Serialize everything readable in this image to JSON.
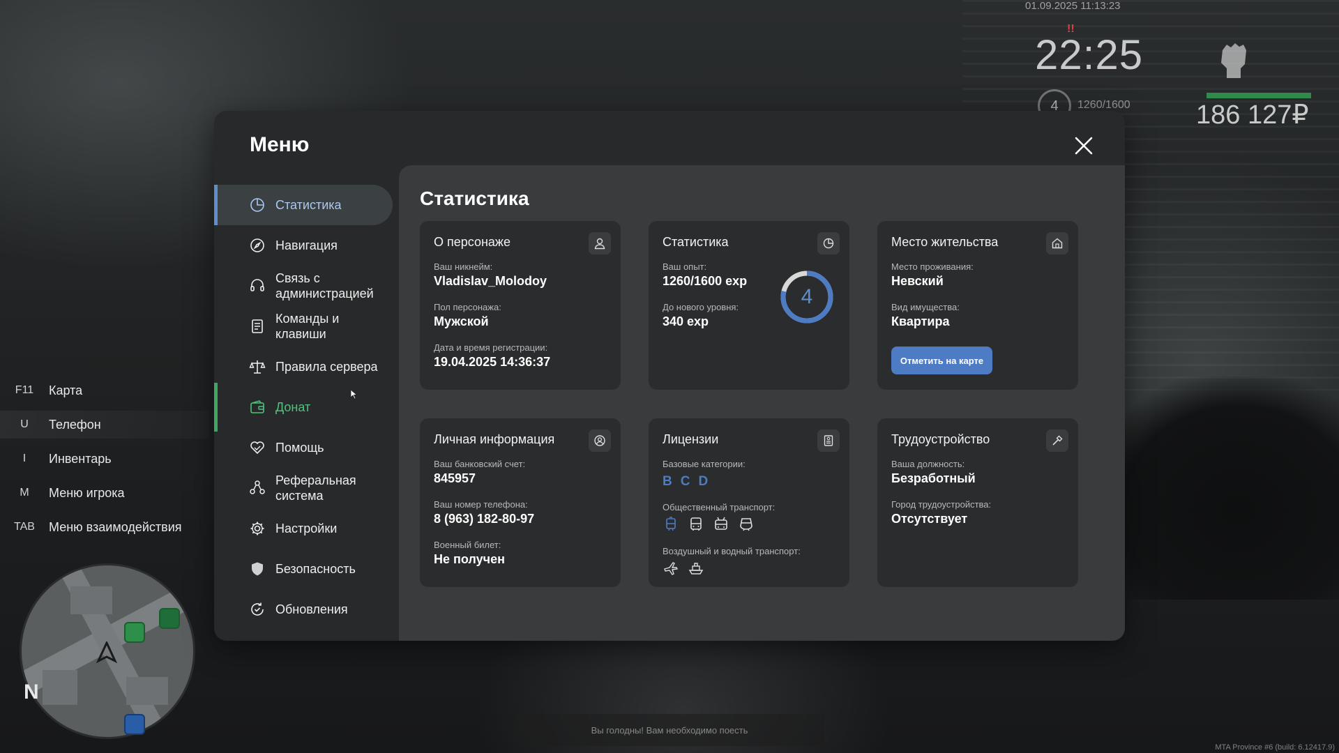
{
  "hud": {
    "datetime": "01.09.2025 11:13:23",
    "time": "22:25",
    "alert": "!!",
    "level": "4",
    "exp": "1260/1600",
    "money": "186 127₽"
  },
  "hotkeys": [
    {
      "key": "F11",
      "label": "Карта"
    },
    {
      "key": "U",
      "label": "Телефон"
    },
    {
      "key": "I",
      "label": "Инвентарь"
    },
    {
      "key": "M",
      "label": "Меню игрока"
    },
    {
      "key": "TAB",
      "label": "Меню взаимодействия"
    }
  ],
  "minimap": {
    "north": "N"
  },
  "menu": {
    "title": "Меню",
    "nav": [
      {
        "label": "Статистика",
        "icon": "chart-pie-icon"
      },
      {
        "label": "Навигация",
        "icon": "compass-icon"
      },
      {
        "label": "Связь с администрацией",
        "icon": "headset-icon"
      },
      {
        "label": "Команды и клавиши",
        "icon": "document-icon"
      },
      {
        "label": "Правила сервера",
        "icon": "scales-icon"
      },
      {
        "label": "Донат",
        "icon": "wallet-icon"
      },
      {
        "label": "Помощь",
        "icon": "handshake-icon"
      },
      {
        "label": "Реферальная система",
        "icon": "people-icon"
      },
      {
        "label": "Настройки",
        "icon": "gear-icon"
      },
      {
        "label": "Безопасность",
        "icon": "shield-icon"
      },
      {
        "label": "Обновления",
        "icon": "refresh-check-icon"
      }
    ]
  },
  "content": {
    "title": "Статистика",
    "character": {
      "title": "О персонаже",
      "nick_label": "Ваш никнейм:",
      "nick": "Vladislav_Molodoy",
      "gender_label": "Пол персонажа:",
      "gender": "Мужской",
      "reg_label": "Дата и время регистрации:",
      "reg": "19.04.2025 14:36:37"
    },
    "stats": {
      "title": "Статистика",
      "exp_label": "Ваш опыт:",
      "exp": "1260/1600 exp",
      "next_label": "До нового уровня:",
      "next": "340 exp",
      "level": "4",
      "progress": 0.7875
    },
    "residence": {
      "title": "Место жительства",
      "place_label": "Место проживания:",
      "place": "Невский",
      "type_label": "Вид имущества:",
      "type": "Квартира",
      "button": "Отметить на карте"
    },
    "personal": {
      "title": "Личная информация",
      "bank_label": "Ваш банковский счет:",
      "bank": "845957",
      "phone_label": "Ваш номер телефона:",
      "phone": "8 (963) 182-80-97",
      "military_label": "Военный билет:",
      "military": "Не получен"
    },
    "licenses": {
      "title": "Лицензии",
      "base_label": "Базовые категории:",
      "categories": [
        "B",
        "C",
        "D"
      ],
      "public_label": "Общественный транспорт:",
      "air_label": "Воздушный и водный транспорт:"
    },
    "employment": {
      "title": "Трудоустройство",
      "job_label": "Ваша должность:",
      "job": "Безработный",
      "city_label": "Город трудоустройства:",
      "city": "Отсутствует"
    }
  },
  "hint": "Вы голодны! Вам необходимо поесть",
  "build": "MTA Province #6 (build: 6.12417.9)",
  "colors": {
    "accent": "#5e8ed0",
    "donate": "#3ca862",
    "panel": "#28292a",
    "card": "#2b2c2d"
  }
}
